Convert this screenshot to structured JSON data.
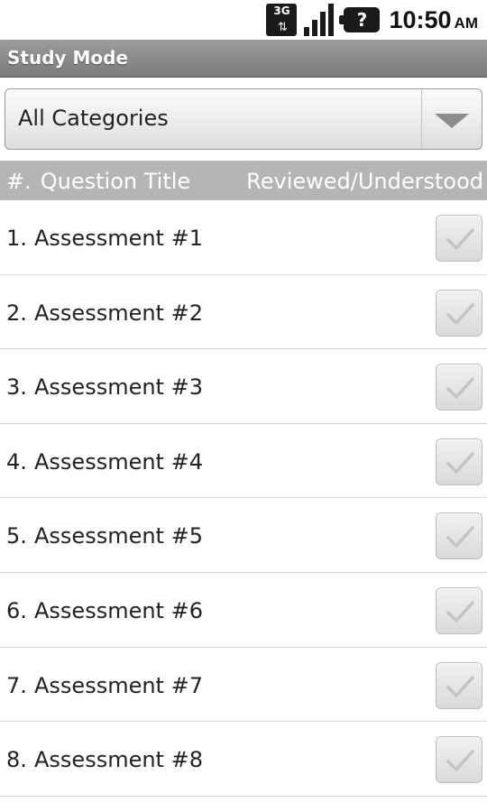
{
  "status_bar": {
    "network": "3G",
    "network_arrows": "⇅",
    "battery_symbol": "?",
    "time": "10:50",
    "ampm": "AM"
  },
  "title_bar": {
    "title": "Study Mode"
  },
  "category_spinner": {
    "selected": "All Categories"
  },
  "column_headers": {
    "number": "#.",
    "question_title": "Question Title",
    "status": "Reviewed/Understood"
  },
  "questions": [
    {
      "number": "1.",
      "title": "Assessment #1",
      "checked": false
    },
    {
      "number": "2.",
      "title": "Assessment #2",
      "checked": false
    },
    {
      "number": "3.",
      "title": "Assessment #3",
      "checked": false
    },
    {
      "number": "4.",
      "title": "Assessment #4",
      "checked": false
    },
    {
      "number": "5.",
      "title": "Assessment #5",
      "checked": false
    },
    {
      "number": "6.",
      "title": "Assessment #6",
      "checked": false
    },
    {
      "number": "7.",
      "title": "Assessment #7",
      "checked": false
    },
    {
      "number": "8.",
      "title": "Assessment #8",
      "checked": false
    }
  ],
  "colors": {
    "title_bar": "#8a8a8a",
    "column_header": "#b5b5b5",
    "checkmark": "#c4c4c4"
  }
}
